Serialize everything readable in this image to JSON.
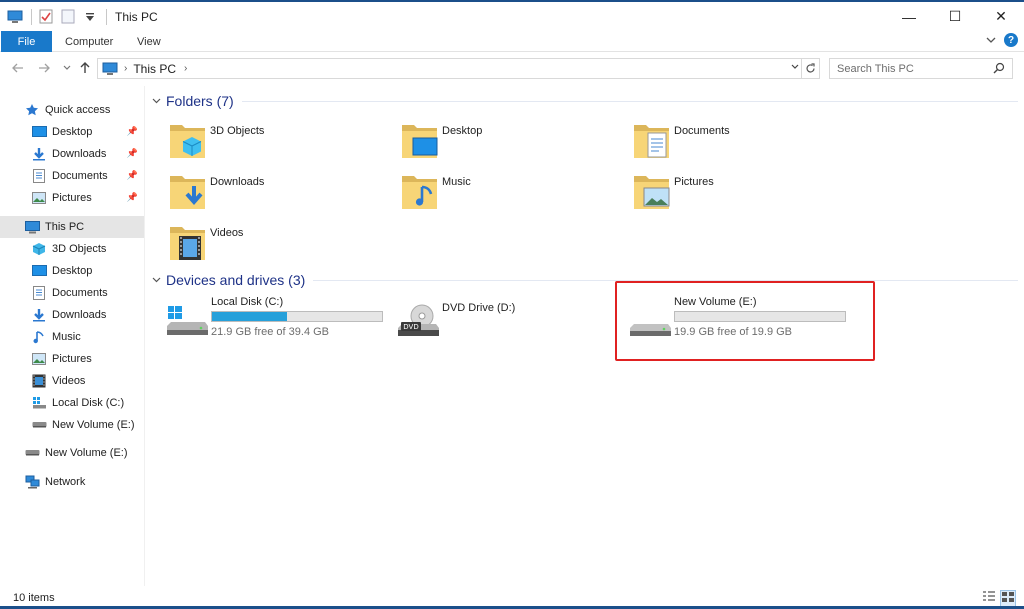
{
  "window": {
    "title": "This PC"
  },
  "window_controls": {
    "minimize": "—",
    "maximize": "☐",
    "close": "✕"
  },
  "ribbon": {
    "file": "File",
    "tabs": [
      "Computer",
      "View"
    ]
  },
  "address": {
    "crumb": "This PC",
    "chevron": "›"
  },
  "search": {
    "placeholder": "Search This PC"
  },
  "sidebar": {
    "items": [
      {
        "label": "Quick access",
        "icon": "star-icon"
      },
      {
        "label": "Desktop",
        "icon": "desktop-icon",
        "pinned": true
      },
      {
        "label": "Downloads",
        "icon": "downloads-icon",
        "pinned": true
      },
      {
        "label": "Documents",
        "icon": "documents-icon",
        "pinned": true
      },
      {
        "label": "Pictures",
        "icon": "pictures-icon",
        "pinned": true
      },
      {
        "label": "This PC",
        "icon": "this-pc-icon",
        "selected": true
      },
      {
        "label": "3D Objects",
        "icon": "3d-objects-icon"
      },
      {
        "label": "Desktop",
        "icon": "desktop-icon"
      },
      {
        "label": "Documents",
        "icon": "documents-icon"
      },
      {
        "label": "Downloads",
        "icon": "downloads-icon"
      },
      {
        "label": "Music",
        "icon": "music-icon"
      },
      {
        "label": "Pictures",
        "icon": "pictures-icon"
      },
      {
        "label": "Videos",
        "icon": "videos-icon"
      },
      {
        "label": "Local Disk (C:)",
        "icon": "local-disk-icon"
      },
      {
        "label": "New Volume (E:)",
        "icon": "drive-icon"
      },
      {
        "label": "New Volume (E:)",
        "icon": "drive-icon"
      },
      {
        "label": "Network",
        "icon": "network-icon"
      }
    ]
  },
  "folders": {
    "title": "Folders (7)",
    "items": [
      {
        "label": "3D Objects",
        "icon": "3d-objects-folder-icon"
      },
      {
        "label": "Desktop",
        "icon": "desktop-folder-icon"
      },
      {
        "label": "Documents",
        "icon": "documents-folder-icon"
      },
      {
        "label": "Downloads",
        "icon": "downloads-folder-icon"
      },
      {
        "label": "Music",
        "icon": "music-folder-icon"
      },
      {
        "label": "Pictures",
        "icon": "pictures-folder-icon"
      },
      {
        "label": "Videos",
        "icon": "videos-folder-icon"
      }
    ]
  },
  "devices": {
    "title": "Devices and drives (3)",
    "items": [
      {
        "label": "Local Disk (C:)",
        "free": "21.9 GB free of 39.4 GB",
        "used_fraction": 0.44,
        "icon": "windows-drive-icon"
      },
      {
        "label": "DVD Drive (D:)",
        "icon": "dvd-drive-icon"
      },
      {
        "label": "New Volume (E:)",
        "free": "19.9 GB free of 19.9 GB",
        "used_fraction": 0.0,
        "icon": "drive-icon"
      }
    ]
  },
  "status": {
    "count": "10 items"
  },
  "colors": {
    "accent": "#1979ca",
    "group_title": "#1e3287",
    "bar_fill": "#26a0da",
    "highlight": "#e02121"
  }
}
